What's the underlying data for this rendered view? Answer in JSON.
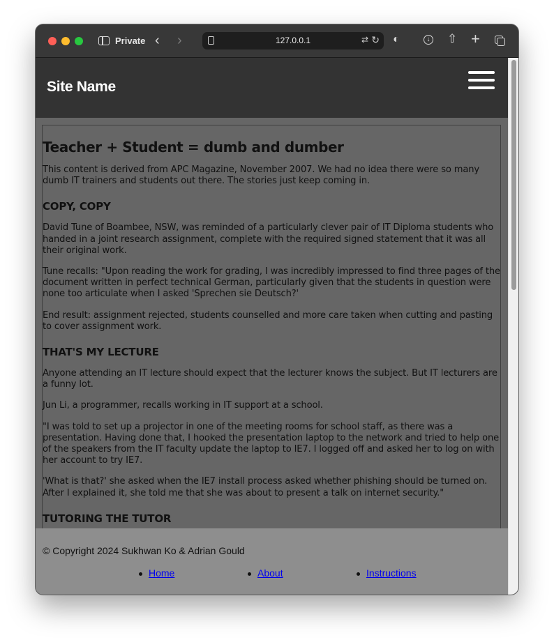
{
  "browser": {
    "mode_label": "Private",
    "url": "127.0.0.1"
  },
  "site": {
    "name": "Site Name"
  },
  "article": {
    "title": "Teacher + Student = dumb and dumber",
    "intro": "This content is derived from APC Magazine, November 2007. We had no idea there were so many dumb IT trainers and students out there. The stories just keep coming in.",
    "sections": [
      {
        "heading": "COPY, COPY",
        "paragraphs": [
          "David Tune of Boambee, NSW, was reminded of a particularly clever pair of IT Diploma students who handed in a joint research assignment, complete with the required signed statement that it was all their original work.",
          "Tune recalls: \"Upon reading the work for grading, I was incredibly impressed to find three pages of the document written in perfect technical German, particularly given that the students in question were none too articulate when I asked 'Sprechen sie Deutsch?'",
          "End result: assignment rejected, students counselled and more care taken when cutting and pasting to cover assignment work."
        ]
      },
      {
        "heading": "THAT'S MY LECTURE",
        "paragraphs": [
          "Anyone attending an IT lecture should expect that the lecturer knows the subject. But IT lecturers are a funny lot.",
          "Jun Li, a programmer, recalls working in IT support at a school.",
          "\"I was told to set up a projector in one of the meeting rooms for school staff, as there was a presentation. Having done that, I hooked the presentation laptop to the network and tried to help one of the speakers from the IT faculty update the laptop to IE7. I logged off and asked her to log on with her account to try IE7.",
          "'What is that?' she asked when the IE7 install process asked whether phishing should be turned on. After I explained it, she told me that she was about to present a talk on internet security.\""
        ]
      },
      {
        "heading": "TUTORING THE TUTOR",
        "paragraphs": []
      }
    ]
  },
  "footer": {
    "copyright": "© Copyright 2024 Sukhwan Ko & Adrian Gould",
    "links": [
      "Home",
      "About",
      "Instructions"
    ]
  }
}
